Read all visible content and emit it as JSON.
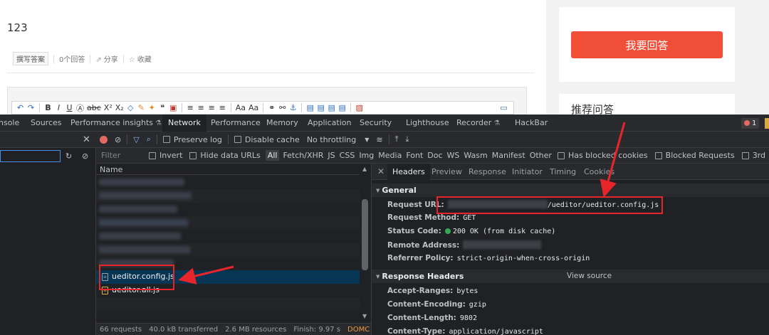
{
  "page": {
    "question_title": "123",
    "actions": {
      "write_answer": "撰写答案",
      "answer_count": "0个回答",
      "share": "分享",
      "favorite": "收藏"
    },
    "answer_button": "我要回答",
    "recommend_title": "推荐问答"
  },
  "devtools": {
    "tabs": [
      "nsole",
      "Sources",
      "Performance insights",
      "Network",
      "Performance",
      "Memory",
      "Application",
      "Security",
      "Lighthouse",
      "Recorder",
      "HackBar"
    ],
    "active_tab": "Network",
    "error_count": "1",
    "toolbar": {
      "preserve_log": "Preserve log",
      "disable_cache": "Disable cache",
      "throttling": "No throttling"
    },
    "filter": {
      "placeholder": "Filter",
      "invert": "Invert",
      "hide_data_urls": "Hide data URLs",
      "types": [
        "All",
        "Fetch/XHR",
        "JS",
        "CSS",
        "Img",
        "Media",
        "Font",
        "Doc",
        "WS",
        "Wasm",
        "Manifest",
        "Other"
      ],
      "has_blocked_cookies": "Has blocked cookies",
      "blocked_requests": "Blocked Requests",
      "third_party": "3rd"
    },
    "list": {
      "name_header": "Name",
      "selected_file": "ueditor.config.js",
      "next_file": "ueditor.all.js"
    },
    "status": {
      "requests": "66 requests",
      "transferred": "40.0 kB transferred",
      "resources": "2.6 MB resources",
      "finish": "Finish: 9.97 s",
      "domcontent": "DOMC"
    },
    "detail_tabs": [
      "Headers",
      "Preview",
      "Response",
      "Initiator",
      "Timing",
      "Cookies"
    ],
    "general": {
      "title": "General",
      "request_url_label": "Request URL:",
      "request_url_value": "/ueditor/ueditor.config.js",
      "request_method_label": "Request Method:",
      "request_method_value": "GET",
      "status_code_label": "Status Code:",
      "status_code_value": "200 OK (from disk cache)",
      "remote_address_label": "Remote Address:",
      "referrer_policy_label": "Referrer Policy:",
      "referrer_policy_value": "strict-origin-when-cross-origin"
    },
    "response_headers": {
      "title": "Response Headers",
      "view_source": "View source",
      "accept_ranges_label": "Accept-Ranges:",
      "accept_ranges_value": "bytes",
      "content_encoding_label": "Content-Encoding:",
      "content_encoding_value": "gzip",
      "content_length_label": "Content-Length:",
      "content_length_value": "9802",
      "content_type_label": "Content-Type:",
      "content_type_value": "application/javascript"
    }
  },
  "colors": {
    "answer_button": "#f04e37",
    "selected_row": "#073655",
    "annotation_red": "#e8252b"
  }
}
